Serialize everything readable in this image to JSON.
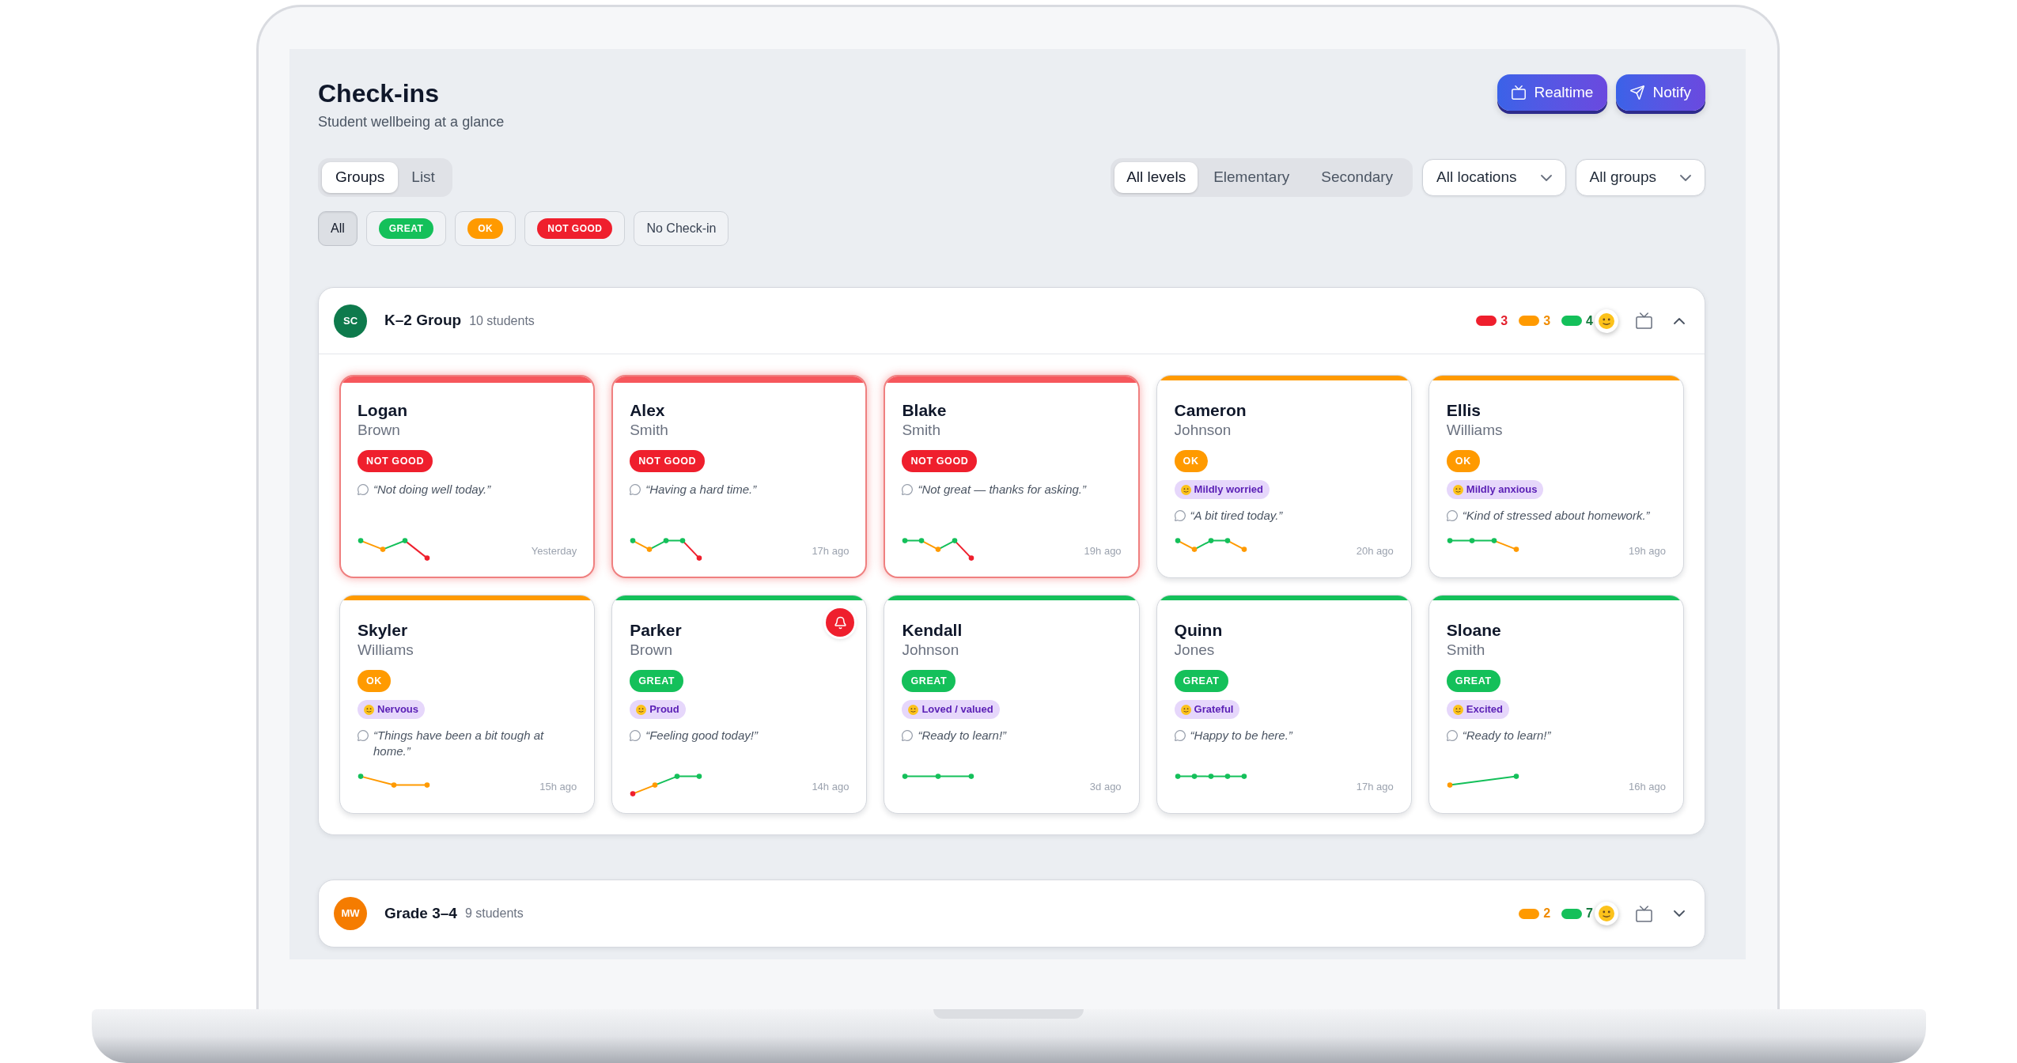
{
  "header": {
    "title": "Check-ins",
    "subtitle": "Student wellbeing at a glance"
  },
  "actions": [
    {
      "kind": "realtime",
      "label": "Realtime"
    },
    {
      "kind": "notify",
      "label": "Notify"
    }
  ],
  "view_tabs": [
    {
      "label": "Groups",
      "selected": true
    },
    {
      "label": "List",
      "selected": false
    }
  ],
  "level_tabs": [
    {
      "label": "All levels",
      "selected": true
    },
    {
      "label": "Elementary",
      "selected": false
    },
    {
      "label": "Secondary",
      "selected": false
    }
  ],
  "dropdowns": [
    {
      "value": "All locations"
    },
    {
      "value": "All groups"
    }
  ],
  "status_filters": [
    {
      "kind": "plain",
      "label": "All",
      "selected": true
    },
    {
      "kind": "great",
      "label": "GREAT",
      "selected": false
    },
    {
      "kind": "ok",
      "label": "OK",
      "selected": false
    },
    {
      "kind": "low",
      "label": "NOT GOOD",
      "selected": false
    },
    {
      "kind": "plain",
      "label": "No Check-in",
      "selected": false
    }
  ],
  "groups": [
    {
      "avatar": {
        "initials": "SC",
        "color": "#0e7a4c"
      },
      "name": "K–2 Group",
      "count": "10 students",
      "tallies": [
        {
          "kind": "low",
          "count": "3"
        },
        {
          "kind": "ok",
          "count": "3"
        },
        {
          "kind": "great",
          "count": "4"
        }
      ],
      "expanded": true,
      "students": [
        {
          "kind": "low",
          "first": "Logan",
          "last": "Brown",
          "badge": "NOT GOOD",
          "comment": "“Not doing well today.”",
          "trend": [
            {
              "kind": "great"
            },
            {
              "kind": "ok"
            },
            {
              "kind": "great"
            },
            {
              "kind": "low"
            }
          ],
          "time": "Yesterday",
          "alert": false
        },
        {
          "kind": "low",
          "first": "Alex",
          "last": "Smith",
          "badge": "NOT GOOD",
          "comment": "“Having a hard time.”",
          "trend": [
            {
              "kind": "great"
            },
            {
              "kind": "ok"
            },
            {
              "kind": "great"
            },
            {
              "kind": "great"
            },
            {
              "kind": "low"
            }
          ],
          "time": "17h ago",
          "alert": false
        },
        {
          "kind": "low",
          "first": "Blake",
          "last": "Smith",
          "badge": "NOT GOOD",
          "comment": "“Not great — thanks for asking.”",
          "trend": [
            {
              "kind": "great"
            },
            {
              "kind": "great"
            },
            {
              "kind": "ok"
            },
            {
              "kind": "great"
            },
            {
              "kind": "low"
            }
          ],
          "time": "19h ago",
          "alert": false
        },
        {
          "kind": "ok",
          "first": "Cameron",
          "last": "Johnson",
          "badge": "OK",
          "mood": "Mildly worried",
          "comment": "“A bit tired today.”",
          "trend": [
            {
              "kind": "great"
            },
            {
              "kind": "ok"
            },
            {
              "kind": "great"
            },
            {
              "kind": "great"
            },
            {
              "kind": "ok"
            }
          ],
          "time": "20h ago",
          "alert": false
        },
        {
          "kind": "ok",
          "first": "Ellis",
          "last": "Williams",
          "badge": "OK",
          "mood": "Mildly anxious",
          "comment": "“Kind of stressed about homework.”",
          "trend": [
            {
              "kind": "great"
            },
            {
              "kind": "great"
            },
            {
              "kind": "great"
            },
            {
              "kind": "ok"
            }
          ],
          "time": "19h ago",
          "alert": false
        },
        {
          "kind": "ok",
          "first": "Skyler",
          "last": "Williams",
          "badge": "OK",
          "mood": "Nervous",
          "comment": "“Things have been a bit tough at home.”",
          "trend": [
            {
              "kind": "great"
            },
            {
              "kind": "ok"
            },
            {
              "kind": "ok"
            }
          ],
          "time": "15h ago",
          "alert": false
        },
        {
          "kind": "great",
          "first": "Parker",
          "last": "Brown",
          "badge": "GREAT",
          "mood": "Proud",
          "comment": "“Feeling good today!”",
          "trend": [
            {
              "kind": "low"
            },
            {
              "kind": "ok"
            },
            {
              "kind": "great"
            },
            {
              "kind": "great"
            }
          ],
          "time": "14h ago",
          "alert": true
        },
        {
          "kind": "great",
          "first": "Kendall",
          "last": "Johnson",
          "badge": "GREAT",
          "mood": "Loved / valued",
          "comment": "“Ready to learn!”",
          "trend": [
            {
              "kind": "great"
            },
            {
              "kind": "great"
            },
            {
              "kind": "great"
            }
          ],
          "time": "3d ago",
          "alert": false
        },
        {
          "kind": "great",
          "first": "Quinn",
          "last": "Jones",
          "badge": "GREAT",
          "mood": "Grateful",
          "comment": "“Happy to be here.”",
          "trend": [
            {
              "kind": "great"
            },
            {
              "kind": "great"
            },
            {
              "kind": "great"
            },
            {
              "kind": "great"
            },
            {
              "kind": "great"
            }
          ],
          "time": "17h ago",
          "alert": false
        },
        {
          "kind": "great",
          "first": "Sloane",
          "last": "Smith",
          "badge": "GREAT",
          "mood": "Excited",
          "comment": "“Ready to learn!”",
          "trend": [
            {
              "kind": "ok"
            },
            {
              "kind": "great"
            }
          ],
          "time": "16h ago",
          "alert": false
        }
      ]
    },
    {
      "avatar": {
        "initials": "MW",
        "color": "#f57c00"
      },
      "name": "Grade 3–4",
      "count": "9 students",
      "tallies": [
        {
          "kind": "ok",
          "count": "2"
        },
        {
          "kind": "great",
          "count": "7"
        }
      ],
      "expanded": false
    }
  ]
}
